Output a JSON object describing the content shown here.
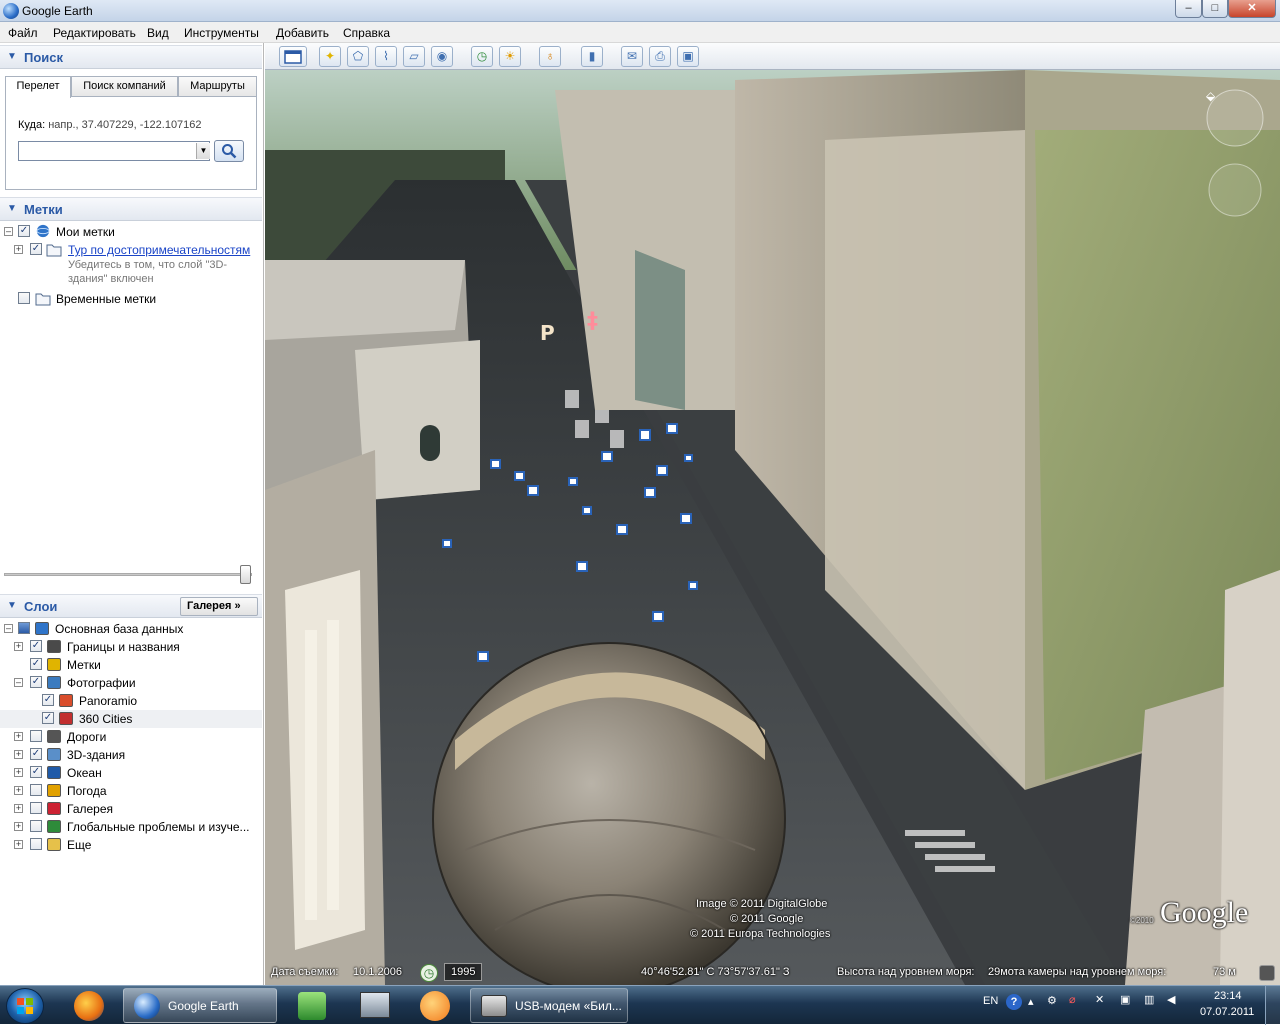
{
  "window": {
    "title": "Google Earth",
    "btn_min": "–",
    "btn_max": "□",
    "btn_close": "✕"
  },
  "menu": [
    "Файл",
    "Редактировать",
    "Вид",
    "Инструменты",
    "Добавить",
    "Справка"
  ],
  "search_panel": {
    "header": "Поиск",
    "tabs": [
      "Перелет",
      "Поиск компаний",
      "Маршруты"
    ],
    "active_tab": "Перелет",
    "fly_to_label": "Куда:",
    "fly_to_hint": "напр., 37.407229, -122.107162",
    "input_value": ""
  },
  "places_panel": {
    "header": "Метки",
    "items": [
      {
        "label": "Мои метки",
        "checked": true,
        "expanded": true,
        "icon": "globe-icon"
      },
      {
        "label": "Тур по достопримечательностям",
        "checked": true,
        "link": true,
        "icon": "folder-icon",
        "description": "Убедитесь в том, что слой \"3D-здания\" включен"
      },
      {
        "label": "Временные метки",
        "checked": false,
        "icon": "folder-icon"
      }
    ]
  },
  "layers_panel": {
    "header": "Слои",
    "gallery_button": "Галерея »",
    "items": [
      {
        "label": "Основная база данных",
        "checked": true,
        "icon": "layers-icon",
        "level": 0
      },
      {
        "label": "Границы и названия",
        "checked": true,
        "icon": "flag-icon",
        "level": 1
      },
      {
        "label": "Метки",
        "checked": true,
        "icon": "placemark-square-icon",
        "level": 1
      },
      {
        "label": "Фотографии",
        "checked": true,
        "icon": "photo-icon",
        "level": 1
      },
      {
        "label": "Panoramio",
        "checked": true,
        "icon": "panoramio-icon",
        "level": 2
      },
      {
        "label": "360 Cities",
        "checked": true,
        "icon": "360-cities-icon",
        "level": 2
      },
      {
        "label": "Дороги",
        "checked": false,
        "icon": "road-icon",
        "level": 1
      },
      {
        "label": "3D-здания",
        "checked": true,
        "icon": "buildings-icon",
        "level": 1
      },
      {
        "label": "Океан",
        "checked": true,
        "icon": "ocean-icon",
        "level": 1
      },
      {
        "label": "Погода",
        "checked": false,
        "icon": "weather-icon",
        "level": 1
      },
      {
        "label": "Галерея",
        "checked": false,
        "icon": "gallery-icon",
        "level": 1
      },
      {
        "label": "Глобальные проблемы и изуче...",
        "checked": false,
        "icon": "global-awareness-icon",
        "level": 1
      },
      {
        "label": "Еще",
        "checked": false,
        "icon": "more-icon",
        "level": 1
      }
    ]
  },
  "toolbar": [
    "hide-sidebar",
    "add-placemark",
    "add-polygon",
    "add-path",
    "add-overlay",
    "record-tour",
    "historical-imagery",
    "sunlight",
    "switch-sky",
    "ruler",
    "email",
    "print",
    "save-image"
  ],
  "map": {
    "attribution": [
      "Image © 2011 DigitalGlobe",
      "© 2011 Google",
      "© 2011 Europa Technologies"
    ],
    "logo": "Google",
    "logo_year": "©2010",
    "status": {
      "imagery_date_label": "Дата съемки:",
      "imagery_date": "10.1.2006",
      "history_year": "1995",
      "coords": "40°46'52.81\" С   73°57'37.61\" З",
      "elevation_label": "Высота над уровнем моря:",
      "eye_alt_label": "29мота камеры над уровнем моря:",
      "eye_alt_value": "73 м"
    }
  },
  "taskbar": {
    "apps": [
      {
        "label": "Google Earth",
        "icon": "google-earth-icon"
      },
      {
        "label": "USB-модем «Бил...",
        "icon": "usb-modem-icon"
      }
    ],
    "lang": "EN",
    "time": "23:14",
    "date": "07.07.2011"
  }
}
